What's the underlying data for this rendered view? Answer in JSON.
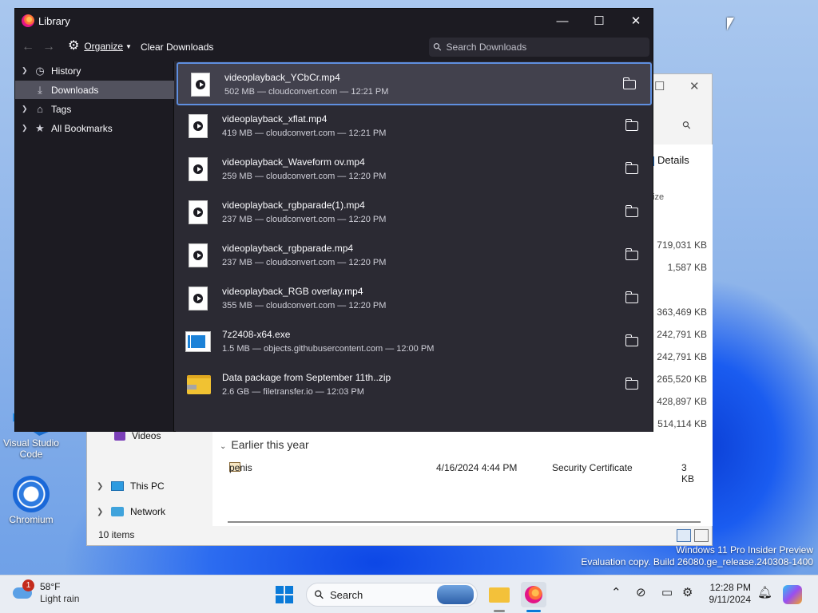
{
  "library": {
    "title": "Library",
    "controls": {
      "minimize": "—",
      "maximize": "☐",
      "close": "✕"
    },
    "toolbar": {
      "back": "←",
      "forward": "→",
      "organize": "Organize",
      "clear_downloads": "Clear Downloads",
      "search_placeholder": "Search Downloads"
    },
    "sidebar": [
      {
        "label": "History",
        "icon": "clock-icon",
        "expandable": true,
        "selected": false
      },
      {
        "label": "Downloads",
        "icon": "download-icon",
        "expandable": false,
        "selected": true
      },
      {
        "label": "Tags",
        "icon": "tag-icon",
        "expandable": true,
        "selected": false
      },
      {
        "label": "All Bookmarks",
        "icon": "star-icon",
        "expandable": true,
        "selected": false
      }
    ],
    "downloads": [
      {
        "name": "videoplayback_YCbCr.mp4",
        "meta": "502 MB — cloudconvert.com — 12:21 PM",
        "type": "video",
        "selected": true
      },
      {
        "name": "videoplayback_xflat.mp4",
        "meta": "419 MB — cloudconvert.com — 12:21 PM",
        "type": "video"
      },
      {
        "name": "videoplayback_Waveform ov.mp4",
        "meta": "259 MB — cloudconvert.com — 12:20 PM",
        "type": "video"
      },
      {
        "name": "videoplayback_rgbparade(1).mp4",
        "meta": "237 MB — cloudconvert.com — 12:20 PM",
        "type": "video"
      },
      {
        "name": "videoplayback_rgbparade.mp4",
        "meta": "237 MB — cloudconvert.com — 12:20 PM",
        "type": "video"
      },
      {
        "name": "videoplayback_RGB overlay.mp4",
        "meta": "355 MB — cloudconvert.com — 12:20 PM",
        "type": "video"
      },
      {
        "name": "7z2408-x64.exe",
        "meta": "1.5 MB — objects.githubusercontent.com — 12:00 PM",
        "type": "exe"
      },
      {
        "name": "Data package from September 11th..zip",
        "meta": "2.6 GB — filetransfer.io — 12:03 PM",
        "type": "zip"
      }
    ]
  },
  "explorer": {
    "details_button": "Details",
    "size_header": "ize",
    "sizes": [
      "719,031 KB",
      "1,587 KB",
      "363,469 KB",
      "242,791 KB",
      "242,791 KB",
      "265,520 KB",
      "428,897 KB",
      "514,114 KB"
    ],
    "nav": {
      "videos": "Videos",
      "this_pc": "This PC",
      "network": "Network"
    },
    "group_label": "Earlier this year",
    "row": {
      "name": "penis",
      "date": "4/16/2024 4:44 PM",
      "type": "Security Certificate",
      "size": "3 KB"
    },
    "status": "10 items"
  },
  "desktop": {
    "icons": [
      "Visual Studio Code",
      "Chromium"
    ],
    "watermark_line1": "Windows 11 Pro Insider Preview",
    "watermark_line2": "Evaluation copy. Build 26080.ge_release.240308-1400"
  },
  "taskbar": {
    "weather_temp": "58°F",
    "weather_desc": "Light rain",
    "weather_badge": "1",
    "search_label": "Search",
    "time": "12:28 PM",
    "date": "9/11/2024",
    "accent": "#0a7ad8"
  }
}
